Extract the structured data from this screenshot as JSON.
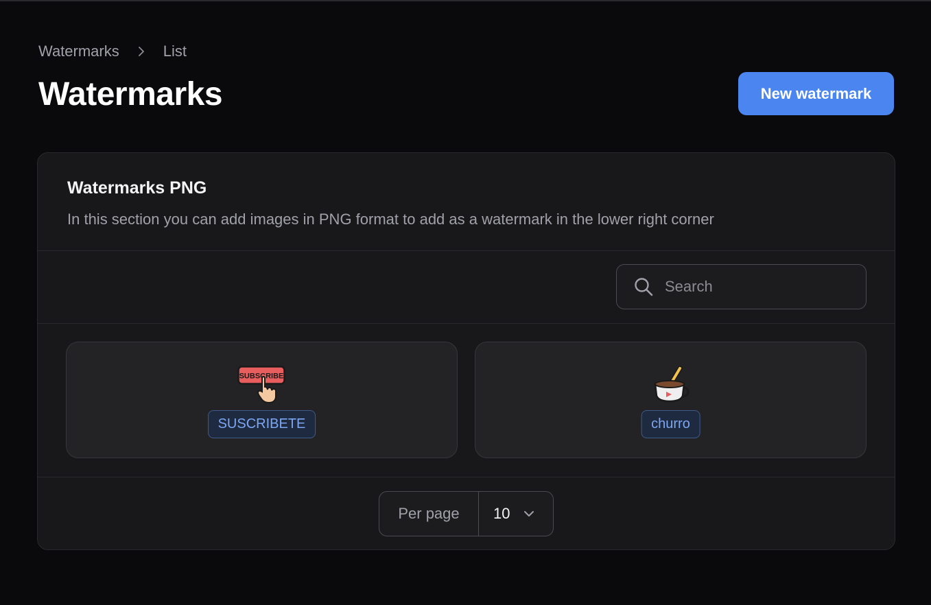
{
  "breadcrumb": {
    "items": [
      "Watermarks",
      "List"
    ]
  },
  "page": {
    "title": "Watermarks"
  },
  "actions": {
    "new_label": "New watermark"
  },
  "section": {
    "title": "Watermarks PNG",
    "description": "In this section you can add images in PNG format to add as a watermark in the lower right corner"
  },
  "search": {
    "placeholder": "Search",
    "value": ""
  },
  "watermarks": [
    {
      "name": "SUSCRIBETE",
      "image_text": "SUBSCRIBE",
      "icon": "subscribe-button-icon"
    },
    {
      "name": "churro",
      "icon": "cup-churro-icon"
    }
  ],
  "pagination": {
    "per_page_label": "Per page",
    "per_page_value": "10"
  },
  "colors": {
    "accent": "#4b86f0",
    "badge_text": "#7da7f4",
    "background": "#0a0a0c",
    "card": "#18181b"
  }
}
